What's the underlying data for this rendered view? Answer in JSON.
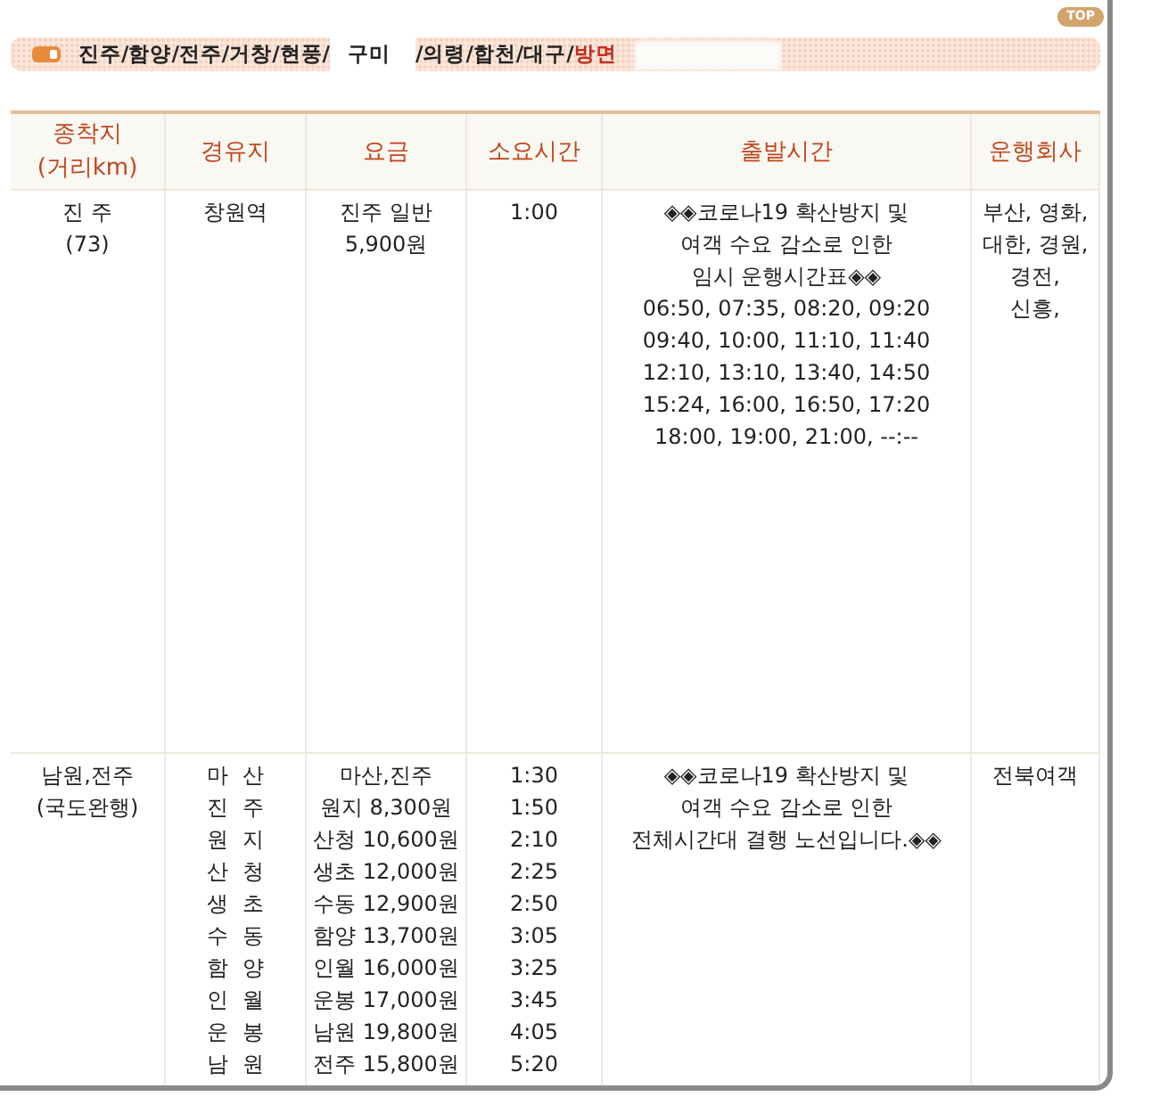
{
  "top_button": "TOP",
  "route_bar": {
    "segments": [
      {
        "text": "진주/함양/전주/거창/현풍/",
        "kind": "plain"
      },
      {
        "text": "구미",
        "kind": "masked"
      },
      {
        "text": "/의령/합천/대구/",
        "kind": "plain"
      },
      {
        "text": "방면",
        "kind": "highlight"
      }
    ]
  },
  "table": {
    "columns": [
      "종착지\n(거리km)",
      "경유지",
      "요금",
      "소요시간",
      "출발시간",
      "운행회사"
    ],
    "rows": [
      {
        "cells": [
          [
            "진 주",
            "(73)"
          ],
          [
            "창원역"
          ],
          [
            "진주 일반",
            "5,900원"
          ],
          [
            "1:00"
          ],
          [
            "◈◈코로나19 확산방지 및",
            "여객 수요 감소로 인한",
            "임시 운행시간표◈◈",
            "06:50, 07:35, 08:20, 09:20",
            "09:40, 10:00, 11:10, 11:40",
            "12:10, 13:10, 13:40, 14:50",
            "15:24, 16:00, 16:50, 17:20",
            "18:00, 19:00, 21:00, --:--"
          ],
          [
            "부산, 영화,",
            "대한, 경원,",
            "경전,",
            "신흥,"
          ]
        ]
      },
      {
        "cells": [
          [
            "남원,전주",
            "(국도완행)"
          ],
          [
            "마  산",
            "진  주",
            "원  지",
            "산  청",
            "생  초",
            "수  동",
            "함  양",
            "인  월",
            "운  봉",
            "남  원"
          ],
          [
            "마산,진주",
            "원지 8,300원",
            "산청 10,600원",
            "생초 12,000원",
            "수동 12,900원",
            "함양 13,700원",
            "인월 16,000원",
            "운봉 17,000원",
            "남원 19,800원",
            "전주 15,800원"
          ],
          [
            "1:30",
            "1:50",
            "2:10",
            "2:25",
            "2:50",
            "3:05",
            "3:25",
            "3:45",
            "4:05",
            "5:20"
          ],
          [
            "◈◈코로나19 확산방지 및",
            "여객 수요 감소로 인한",
            "전체시간대 결행 노선입니다.◈◈"
          ],
          [
            "전북여객"
          ]
        ]
      }
    ]
  }
}
